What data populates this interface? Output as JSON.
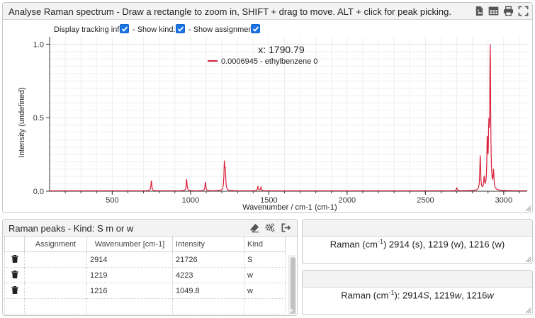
{
  "spectrum_panel": {
    "title": "Analyse Raman spectrum - Draw a rectangle to zoom in, SHIFT + drag to move. ALT + click for peak picking.",
    "tracking_label": "Display tracking info:",
    "show_kind_label": "- Show kind:",
    "show_assignment_label": "- Show assignment:",
    "tracking_checked": true,
    "show_kind_checked": true,
    "show_assignment_checked": true,
    "icons": [
      "image-export-icon",
      "table-export-icon",
      "print-icon",
      "fullscreen-icon"
    ]
  },
  "chart_data": {
    "type": "line",
    "xlabel": "Wavenumber / cm-1 (cm-1)",
    "ylabel": "Intensity (undefined)",
    "xlim": [
      100,
      3150
    ],
    "ylim": [
      0,
      1.05
    ],
    "x_ticks": [
      500,
      1000,
      1500,
      2000,
      2500,
      3000
    ],
    "y_ticks": [
      0.0,
      0.5,
      1.0
    ],
    "y_tick_labels": [
      "0.0",
      "0.5",
      "1.0"
    ],
    "tracking_x": "x: 1790.79",
    "legend_entry": "0.0006945 - ethylbenzene 0",
    "color": "#d9213a",
    "series": [
      {
        "name": "ethylbenzene 0",
        "peaks": [
          {
            "x": 750,
            "y": 0.07
          },
          {
            "x": 975,
            "y": 0.08
          },
          {
            "x": 1095,
            "y": 0.06
          },
          {
            "x": 1216,
            "y": 0.18
          },
          {
            "x": 1222,
            "y": 0.12
          },
          {
            "x": 1430,
            "y": 0.03
          },
          {
            "x": 1450,
            "y": 0.025
          },
          {
            "x": 2700,
            "y": 0.02
          },
          {
            "x": 2850,
            "y": 0.24
          },
          {
            "x": 2875,
            "y": 0.08
          },
          {
            "x": 2895,
            "y": 0.32
          },
          {
            "x": 2905,
            "y": 0.35
          },
          {
            "x": 2914,
            "y": 1.0
          },
          {
            "x": 2935,
            "y": 0.12
          }
        ]
      }
    ]
  },
  "peaks_panel": {
    "title": "Raman peaks - Kind: S m or w",
    "icons": [
      "eraser-icon",
      "settings-icon",
      "export-icon"
    ],
    "columns": [
      "",
      "Assignment",
      "Wavenumber [cm-1]",
      "Intensity",
      "Kind"
    ],
    "rows": [
      {
        "assignment": "",
        "wavenumber": "2914",
        "intensity": "21726",
        "kind": "S"
      },
      {
        "assignment": "",
        "wavenumber": "1219",
        "intensity": "4223",
        "kind": "w"
      },
      {
        "assignment": "",
        "wavenumber": "1216",
        "intensity": "1049.8",
        "kind": "w"
      },
      {
        "assignment": "",
        "wavenumber": "",
        "intensity": "",
        "kind": ""
      }
    ]
  },
  "summary1": {
    "prefix": "Raman (cm",
    "sup": "-1",
    "rest": ") 2914 (s), 1219 (w), 1216 (w)"
  },
  "summary2": {
    "prefix": "Raman (cm",
    "sup": "-1",
    "rest1": "): 2914",
    "k1": "S",
    "rest2": ", 1219",
    "k2": "w",
    "rest3": ", 1216",
    "k3": "w"
  }
}
